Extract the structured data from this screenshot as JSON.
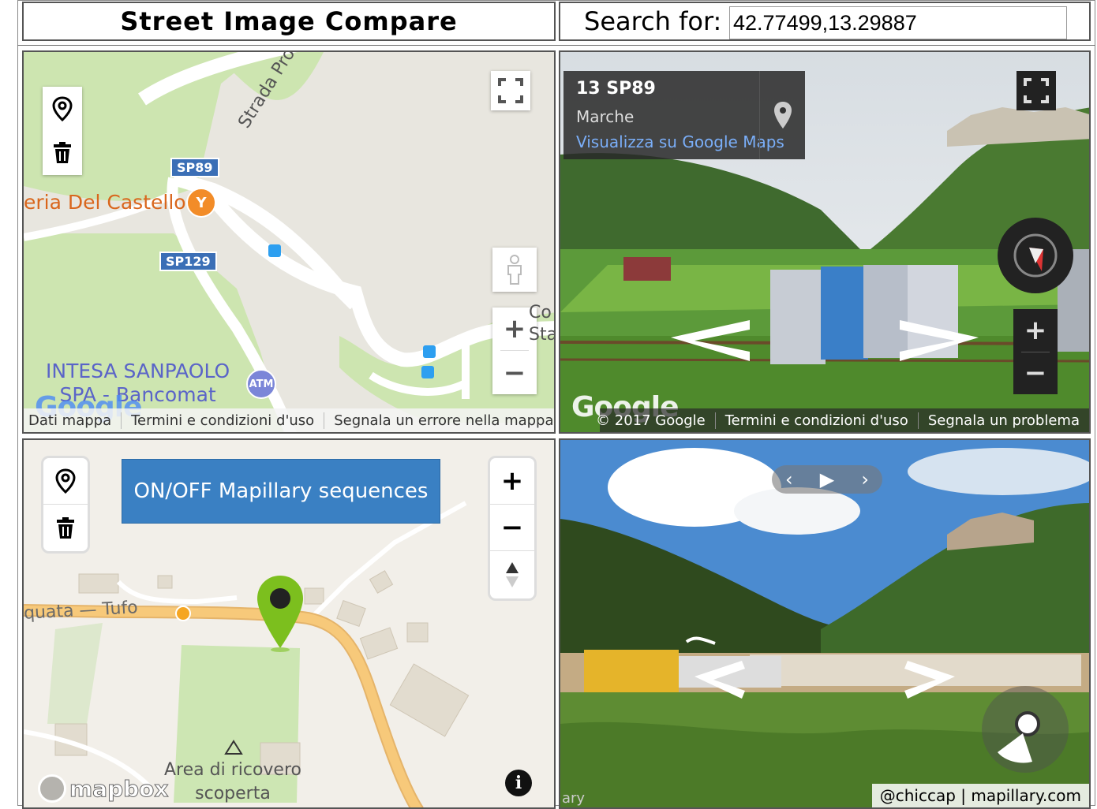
{
  "header": {
    "title": "Street Image Compare",
    "search_label": "Search for:",
    "search_value": "42.77499,13.29887"
  },
  "google_map": {
    "road_sp89": "SP89",
    "road_sp129": "SP129",
    "road_strada": "Strada Provinciale",
    "poi_restaurant": "eria Del Castello",
    "poi_bank_line1": "INTESA SANPAOLO",
    "poi_bank_line2": "SPA - Bancomat",
    "atm_badge": "ATM",
    "partial_label_1": "Co",
    "partial_label_2": "Sta",
    "logo": "Google",
    "attrib_data": "Dati mappa",
    "attrib_terms": "Termini e condizioni d'uso",
    "attrib_report": "Segnala un errore nella mappa"
  },
  "streetview": {
    "address": "13 SP89",
    "region": "Marche",
    "link": "Visualizza su Google Maps",
    "logo": "Google",
    "attrib_copyright": "© 2017 Google",
    "attrib_terms": "Termini e condizioni d'uso",
    "attrib_report": "Segnala un problema"
  },
  "mapbox": {
    "toggle_label": "ON/OFF Mapillary sequences",
    "road_label": "quata — Tufo",
    "poi_line1": "Area di ricovero",
    "poi_line2": "scoperta",
    "logo": "mapbox",
    "info_glyph": "i"
  },
  "mapillary": {
    "attribution": "@chiccap | mapillary.com",
    "corner_text": "ary"
  },
  "colors": {
    "mapillary_button": "#3a80c3",
    "marker_green": "#7cbf1e",
    "road_orange": "#f7c97a",
    "sv_link": "#7aaef8",
    "park_green": "#cde5b0",
    "shield_blue": "#3b6fb6"
  }
}
